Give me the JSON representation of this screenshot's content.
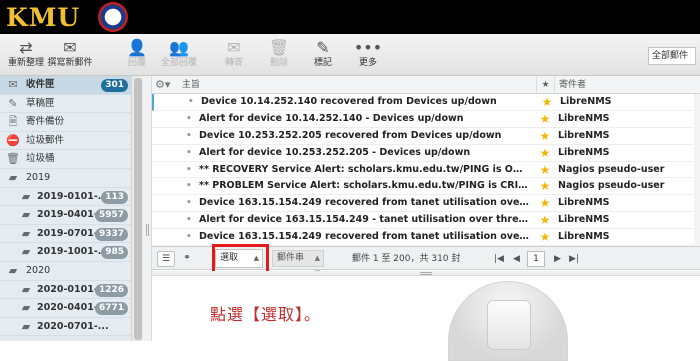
{
  "brand": {
    "logo_text": "KMU"
  },
  "toolbar": {
    "buttons": [
      {
        "label": "重新整理",
        "icon": "refresh-icon",
        "disabled": false
      },
      {
        "label": "撰寫新郵件",
        "icon": "compose-icon",
        "disabled": false
      },
      {
        "label": "回覆",
        "icon": "reply-icon",
        "disabled": true
      },
      {
        "label": "全部回覆",
        "icon": "reply-all-icon",
        "disabled": true
      },
      {
        "label": "轉寄",
        "icon": "forward-icon",
        "disabled": true
      },
      {
        "label": "刪除",
        "icon": "trash-icon",
        "disabled": true
      },
      {
        "label": "標記",
        "icon": "mark-icon",
        "disabled": false
      },
      {
        "label": "更多",
        "icon": "more-icon",
        "disabled": false
      }
    ],
    "folder_select": "全部郵件"
  },
  "sidebar": {
    "items": [
      {
        "label": "收件匣",
        "badge": "301",
        "icon": "inbox-icon",
        "active": true,
        "sub": false
      },
      {
        "label": "草稿匣",
        "badge": "",
        "icon": "pencil-icon",
        "active": false,
        "sub": false
      },
      {
        "label": "寄件備份",
        "badge": "",
        "icon": "sent-icon",
        "active": false,
        "sub": false
      },
      {
        "label": "垃圾郵件",
        "badge": "",
        "icon": "junk-icon",
        "active": false,
        "sub": false
      },
      {
        "label": "垃圾桶",
        "badge": "",
        "icon": "trash-icon",
        "active": false,
        "sub": false
      },
      {
        "label": "2019",
        "badge": "",
        "icon": "folder-icon",
        "active": false,
        "sub": false
      },
      {
        "label": "2019-0101-...",
        "badge": "113",
        "icon": "folder-icon",
        "active": false,
        "sub": true
      },
      {
        "label": "2019-0401-...",
        "badge": "5957",
        "icon": "folder-icon",
        "active": false,
        "sub": true
      },
      {
        "label": "2019-0701-...",
        "badge": "9337",
        "icon": "folder-icon",
        "active": false,
        "sub": true
      },
      {
        "label": "2019-1001-...",
        "badge": "985",
        "icon": "folder-icon",
        "active": false,
        "sub": true
      },
      {
        "label": "2020",
        "badge": "",
        "icon": "folder-icon",
        "active": false,
        "sub": false
      },
      {
        "label": "2020-0101-...",
        "badge": "1226",
        "icon": "folder-icon",
        "active": false,
        "sub": true
      },
      {
        "label": "2020-0401-...",
        "badge": "6771",
        "icon": "folder-icon",
        "active": false,
        "sub": true
      },
      {
        "label": "2020-0701-...",
        "badge": "",
        "icon": "folder-icon",
        "active": false,
        "sub": true
      }
    ]
  },
  "message_list": {
    "columns": {
      "subject": "主旨",
      "from": "寄件者"
    },
    "rows": [
      {
        "subject": "Device 10.14.252.140 recovered from Devices up/down",
        "from": "LibreNMS",
        "flagged": true
      },
      {
        "subject": "Alert for device 10.14.252.140 - Devices up/down",
        "from": "LibreNMS",
        "flagged": true
      },
      {
        "subject": "Device 10.253.252.205 recovered from Devices up/down",
        "from": "LibreNMS",
        "flagged": true
      },
      {
        "subject": "Alert for device 10.253.252.205 - Devices up/down",
        "from": "LibreNMS",
        "flagged": true
      },
      {
        "subject": "** RECOVERY Service Alert: scholars.kmu.edu.tw/PING is OK **",
        "from": "Nagios pseudo-user",
        "flagged": true
      },
      {
        "subject": "** PROBLEM Service Alert: scholars.kmu.edu.tw/PING is CRITICA...",
        "from": "Nagios pseudo-user",
        "flagged": true
      },
      {
        "subject": "Device 163.15.154.249 recovered from tanet utilisation over thre...",
        "from": "LibreNMS",
        "flagged": true
      },
      {
        "subject": "Alert for device 163.15.154.249 - tanet utilisation over threshold",
        "from": "LibreNMS",
        "flagged": true
      },
      {
        "subject": "Device 163.15.154.249 recovered from tanet utilisation over thre...",
        "from": "LibreNMS",
        "flagged": true
      }
    ]
  },
  "footer": {
    "select_label": "選取",
    "threads_label": "郵件串",
    "count_text": "郵件 1 至 200，共 310 封",
    "page": "1"
  },
  "preview": {
    "instruction": "點選【選取】。"
  },
  "colors": {
    "header_bg": "#000000",
    "logo": "#f0c030",
    "highlight": "#e41a1a",
    "instruction": "#c22c2c",
    "star": "#f2b807",
    "unread_badge": "#1f6f9c"
  }
}
